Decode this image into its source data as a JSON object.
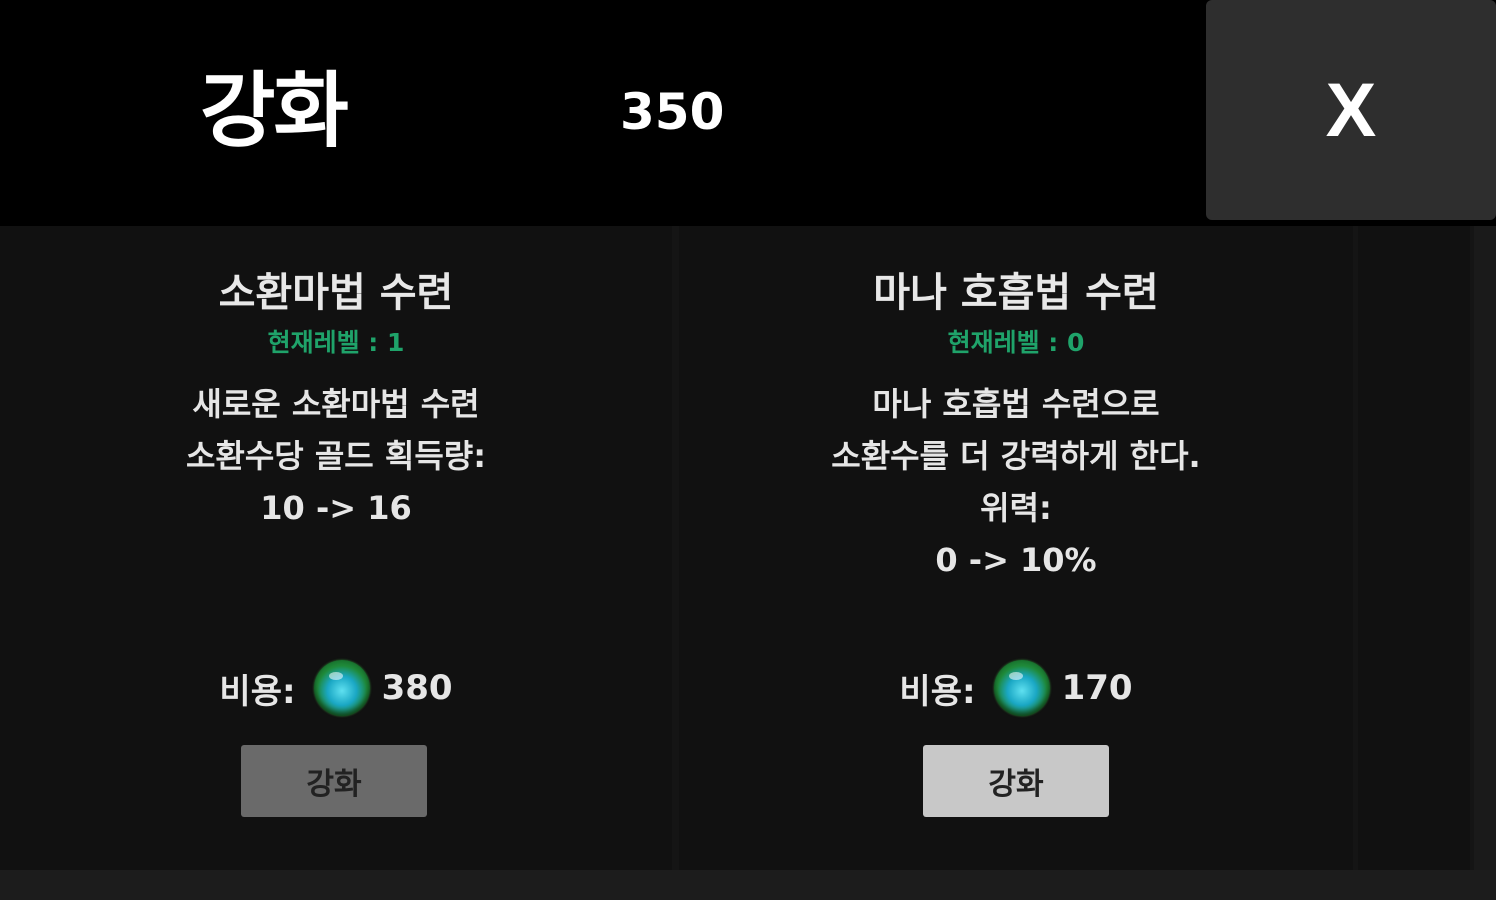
{
  "header": {
    "title": "강화",
    "currency_amount": "350",
    "close_label": "X"
  },
  "cards": [
    {
      "title": "소환마법 수련",
      "level": "현재레벨 : 1",
      "description": [
        "새로운 소환마법 수련",
        "소환수당 골드 획득량:",
        "10 -> 16"
      ],
      "cost_label": "비용:",
      "cost_icon": "green-gem-icon",
      "cost_value": "380",
      "button_label": "강화",
      "button_enabled": false
    },
    {
      "title": "마나 호흡법 수련",
      "level": "현재레벨 : 0",
      "description": [
        "마나 호흡법 수련으로",
        "소환수를 더 강력하게 한다.",
        "위력:",
        "0 -> 10%"
      ],
      "cost_label": "비용:",
      "cost_icon": "green-gem-icon",
      "cost_value": "170",
      "button_label": "강화",
      "button_enabled": true
    }
  ],
  "colors": {
    "level_text": "#1fa36a",
    "header_bg": "#000000",
    "card_bg": "#111111",
    "close_bg": "#2e2e2e",
    "button_disabled": "#6a6a6a",
    "button_enabled": "#c8c8c8"
  }
}
